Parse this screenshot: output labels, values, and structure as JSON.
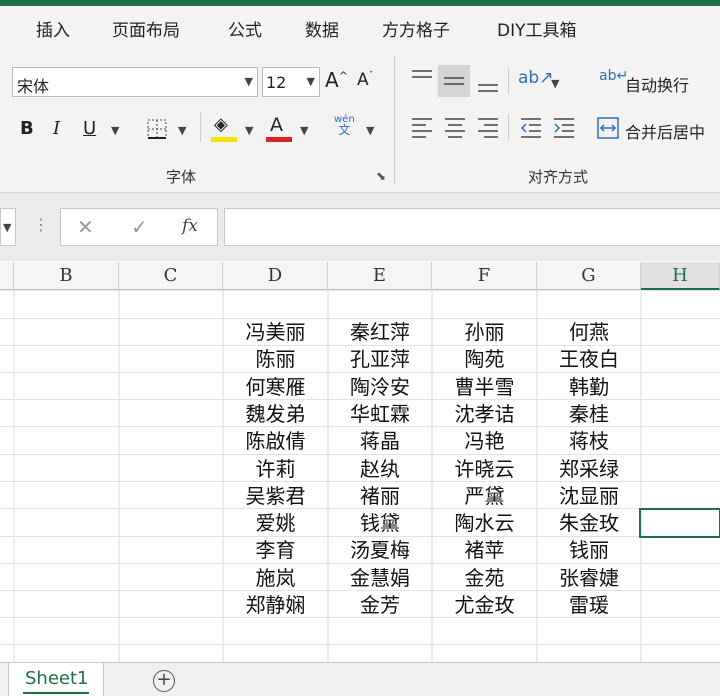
{
  "ribbon_tabs": [
    "插入",
    "页面布局",
    "公式",
    "数据",
    "方方格子",
    "DIY工具箱"
  ],
  "font": {
    "name": "宋体",
    "size": "12",
    "group_label": "字体",
    "font_color": "#e02020",
    "fill_color": "#f2e600"
  },
  "alignment": {
    "wrap_text": "自动换行",
    "merge_center": "合并后居中",
    "group_label": "对齐方式"
  },
  "formula_bar": {
    "fx": "fx",
    "content": ""
  },
  "columns": [
    "B",
    "C",
    "D",
    "E",
    "F",
    "G",
    "H"
  ],
  "selected_column": "H",
  "rows": [
    [
      "冯美丽",
      "秦红萍",
      "孙丽",
      "何燕"
    ],
    [
      "陈丽",
      "孔亚萍",
      "陶苑",
      "王夜白"
    ],
    [
      "何寒雁",
      "陶泠安",
      "曹半雪",
      "韩勤"
    ],
    [
      "魏发弟",
      "华虹霖",
      "沈孝诘",
      "秦桂"
    ],
    [
      "陈啟倩",
      "蒋晶",
      "冯艳",
      "蒋枝"
    ],
    [
      "许莉",
      "赵纨",
      "许晓云",
      "郑采绿"
    ],
    [
      "吴紫君",
      "褚丽",
      "严黛",
      "沈显丽"
    ],
    [
      "爱姚",
      "钱黛",
      "陶水云",
      "朱金玫"
    ],
    [
      "李育",
      "汤夏梅",
      "褚苹",
      "钱丽"
    ],
    [
      "施岚",
      "金慧娟",
      "金苑",
      "张睿婕"
    ],
    [
      "郑静娴",
      "金芳",
      "尤金玫",
      "雷瑗"
    ]
  ],
  "sheet_tabs": [
    "Sheet1"
  ],
  "accent_color": "#1e7145"
}
